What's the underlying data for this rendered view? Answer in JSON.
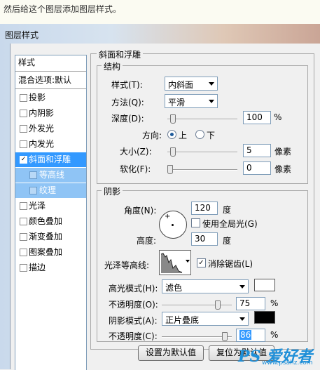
{
  "caption": "然后给这个图层添加图层样式。",
  "dialog": {
    "title": "图层样式"
  },
  "styles_list": {
    "header": "样式",
    "blend_options": "混合选项:默认",
    "items": [
      {
        "label": "投影",
        "checked": false
      },
      {
        "label": "内阴影",
        "checked": false
      },
      {
        "label": "外发光",
        "checked": false
      },
      {
        "label": "内发光",
        "checked": false
      },
      {
        "label": "斜面和浮雕",
        "checked": true,
        "selected": true
      },
      {
        "label": "等高线",
        "checked": false,
        "sub": true
      },
      {
        "label": "纹理",
        "checked": false,
        "sub": true
      },
      {
        "label": "光泽",
        "checked": false
      },
      {
        "label": "颜色叠加",
        "checked": false
      },
      {
        "label": "渐变叠加",
        "checked": false
      },
      {
        "label": "图案叠加",
        "checked": false
      },
      {
        "label": "描边",
        "checked": false
      }
    ]
  },
  "bevel": {
    "section_title": "斜面和浮雕",
    "structure": {
      "title": "结构",
      "style_label": "样式(T):",
      "style_value": "内斜面",
      "technique_label": "方法(Q):",
      "technique_value": "平滑",
      "depth_label": "深度(D):",
      "depth_value": "100",
      "depth_level_percent": 100,
      "percent_unit": "%",
      "direction_label": "方向:",
      "direction_up": "上",
      "direction_down": "下",
      "direction_selected": "上",
      "size_label": "大小(Z):",
      "size_value": "5",
      "size_unit": "像素",
      "soften_label": "软化(F):",
      "soften_value": "0",
      "soften_unit": "像素"
    },
    "shading": {
      "title": "阴影",
      "angle_label": "角度(N):",
      "angle_value": "120",
      "angle_unit": "度",
      "global_light_label": "使用全局光(G)",
      "global_light_checked": false,
      "altitude_label": "高度:",
      "altitude_value": "30",
      "altitude_unit": "度",
      "gloss_contour_label": "光泽等高线:",
      "anti_alias_label": "消除锯齿(L)",
      "anti_alias_checked": true,
      "highlight_mode_label": "高光模式(H):",
      "highlight_mode_value": "滤色",
      "highlight_color": "#ffffff",
      "highlight_opacity_label": "不透明度(O):",
      "highlight_opacity_value": "75",
      "shadow_mode_label": "阴影模式(A):",
      "shadow_mode_value": "正片叠底",
      "shadow_color": "#000000",
      "shadow_opacity_label": "不透明度(C):",
      "shadow_opacity_value": "86"
    },
    "buttons": {
      "make_default": "设置为默认值",
      "reset_default": "复位为默认值"
    }
  },
  "watermark": {
    "brand": "PS 爱好者",
    "site": "www.psahz.com"
  }
}
